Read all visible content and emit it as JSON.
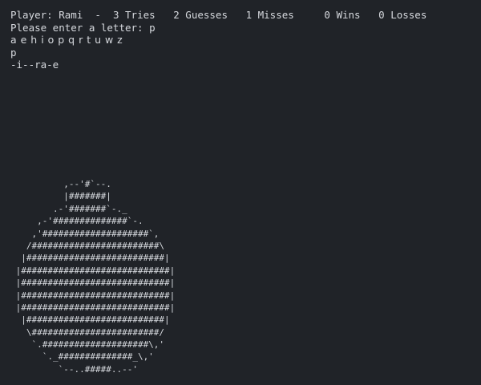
{
  "status": {
    "player_label": "Player:",
    "player_name": "Rami",
    "separator": "-",
    "tries": "3 Tries",
    "guesses": "2 Guesses",
    "misses": "1 Misses",
    "wins": "0 Wins",
    "losses": "0 Losses"
  },
  "prompt": {
    "text": "Please enter a letter: ",
    "input_value": "p"
  },
  "letters_remaining": "a e h i o p q r t u w z",
  "last_guess": "p",
  "word_progress": "-i--ra-e",
  "bomb_art": [
    "          ,--'#`--.",
    "          |#######|",
    "        .-'#######`-._",
    "     ,-'##############`-.",
    "    ,'####################`,",
    "   /########################\\",
    "  |##########################|",
    " |############################|",
    " |############################|",
    " |############################|",
    " |############################|",
    "  |##########################|",
    "   \\########################/",
    "    `.####################\\,'",
    "      `._##############_\\,'",
    "         `--..#####..--'"
  ]
}
